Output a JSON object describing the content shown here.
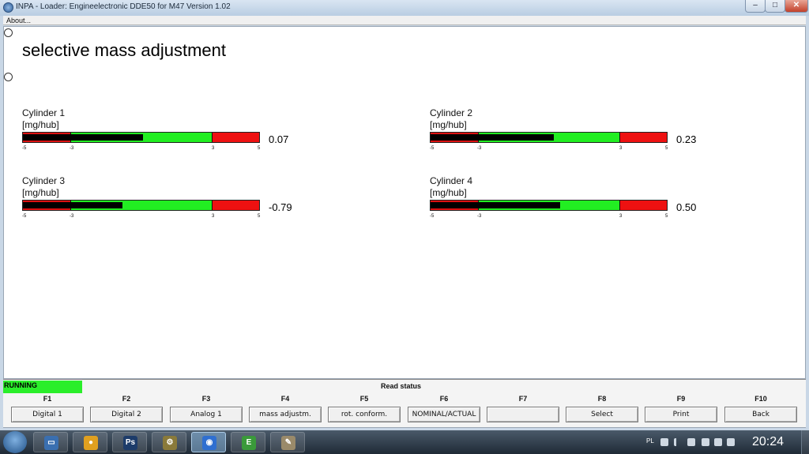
{
  "window": {
    "title": "INPA - Loader:  Engineelectronic DDE50 for M47 Version 1.02",
    "minimize_glyph": "–",
    "maximize_glyph": "□",
    "close_glyph": "✕"
  },
  "menu": {
    "about": "About..."
  },
  "main": {
    "title": "selective mass adjustment",
    "cylinders": [
      {
        "name": "Cylinder 1",
        "unit": "[mg/hub]",
        "value": "0.07",
        "numeric_value": 0.07,
        "scale_min": -5,
        "scale_max": 5,
        "ticks": [
          "-5",
          "-3",
          "3",
          "5"
        ]
      },
      {
        "name": "Cylinder 2",
        "unit": "[mg/hub]",
        "value": "0.23",
        "numeric_value": 0.23,
        "scale_min": -5,
        "scale_max": 5,
        "ticks": [
          "-5",
          "-3",
          "3",
          "5"
        ]
      },
      {
        "name": "Cylinder 3",
        "unit": "[mg/hub]",
        "value": "-0.79",
        "numeric_value": -0.79,
        "scale_min": -5,
        "scale_max": 5,
        "ticks": [
          "-5",
          "-3",
          "3",
          "5"
        ]
      },
      {
        "name": "Cylinder 4",
        "unit": "[mg/hub]",
        "value": "0.50",
        "numeric_value": 0.5,
        "scale_min": -5,
        "scale_max": 5,
        "ticks": [
          "-5",
          "-3",
          "3",
          "5"
        ]
      }
    ]
  },
  "status": {
    "running": "RUNNING",
    "text": "Read status"
  },
  "fkeys": [
    {
      "key": "F1",
      "label": "Digital 1"
    },
    {
      "key": "F2",
      "label": "Digital 2"
    },
    {
      "key": "F3",
      "label": "Analog 1"
    },
    {
      "key": "F4",
      "label": "mass adjustm."
    },
    {
      "key": "F5",
      "label": "rot. conform."
    },
    {
      "key": "F6",
      "label": "NOMINAL/ACTUAL"
    },
    {
      "key": "F7",
      "label": ""
    },
    {
      "key": "F8",
      "label": "Select"
    },
    {
      "key": "F9",
      "label": "Print"
    },
    {
      "key": "F10",
      "label": "Back"
    }
  ],
  "taskbar": {
    "apps": [
      {
        "icon": "network-app-icon",
        "glyph": "▭",
        "color": "#3a6fb0"
      },
      {
        "icon": "chrome-icon",
        "glyph": "●",
        "color": "#e0a020"
      },
      {
        "icon": "photoshop-icon",
        "glyph": "Ps",
        "color": "#1d3c6a"
      },
      {
        "icon": "tools-icon",
        "glyph": "⚙",
        "color": "#8a7a3a"
      },
      {
        "icon": "bmw-icon",
        "glyph": "◉",
        "color": "#2f6fd0"
      },
      {
        "icon": "ediabas-icon",
        "glyph": "E",
        "color": "#3a9a3a"
      },
      {
        "icon": "paint-icon",
        "glyph": "✎",
        "color": "#9a8a6a"
      }
    ],
    "active_app": 4,
    "tray_lang": "PL",
    "clock": "20:24"
  }
}
